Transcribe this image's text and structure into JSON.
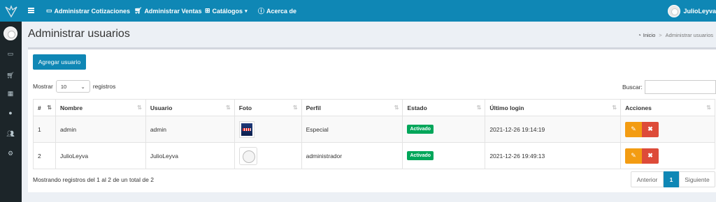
{
  "nav": {
    "items": [
      {
        "label": "Administrar Cotizaciones",
        "icon": "invoice-icon"
      },
      {
        "label": "Administrar Ventas",
        "icon": "cart-icon"
      },
      {
        "label": "Catálogos",
        "icon": "plus-square-icon"
      },
      {
        "label": "Acerca de",
        "icon": "info-icon"
      }
    ],
    "user_name": "JulioLeyva"
  },
  "page": {
    "title": "Administrar usuarios",
    "breadcrumb_home": "Inicio",
    "breadcrumb_current": "Administrar usuarios"
  },
  "toolbar": {
    "add_label": "Agregar usuario",
    "show_prefix": "Mostrar",
    "show_value": "10",
    "show_suffix": "registros",
    "search_label": "Buscar:"
  },
  "table": {
    "headers": [
      "#",
      "Nombre",
      "Usuario",
      "Foto",
      "Perfil",
      "Estado",
      "Último login",
      "Acciones"
    ],
    "rows": [
      {
        "num": "1",
        "nombre": "admin",
        "usuario": "admin",
        "perfil": "Especial",
        "estado": "Activado",
        "login": "2021-12-26 19:14:19"
      },
      {
        "num": "2",
        "nombre": "JulioLeyva",
        "usuario": "JulioLeyva",
        "perfil": "administrador",
        "estado": "Activado",
        "login": "2021-12-26 19:49:13"
      }
    ]
  },
  "footer": {
    "info": "Mostrando registros del 1 al 2 de un total de 2",
    "prev": "Anterior",
    "page": "1",
    "next": "Siguiente"
  },
  "colors": {
    "primary": "#0f87b5",
    "sidebar": "#1c2529",
    "success": "#00a65a",
    "warning": "#f39c12",
    "danger": "#dd4b39"
  }
}
